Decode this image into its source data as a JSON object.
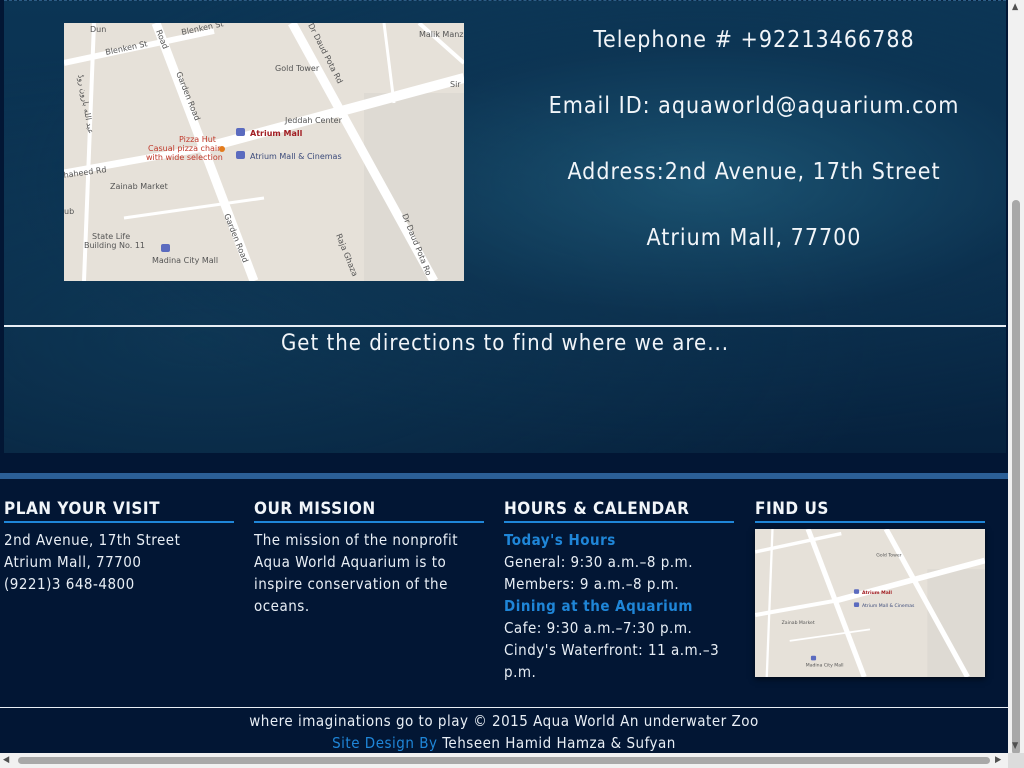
{
  "contact": {
    "telephone": "Telephone # +92213466788",
    "email": "Email ID: aquaworld@aquarium.com",
    "address": "Address:2nd Avenue, 17th Street",
    "mall": "Atrium Mall, 77700",
    "directions": "Get the directions to find where we are..."
  },
  "map": {
    "labels": {
      "dunes": "Dun",
      "blenken1": "Blenken St",
      "blenken2": "Blenken St",
      "garden_road_top": "Garden Road",
      "road": "Road",
      "dr_daud_pota_top": "Dr Daud Pota Rd",
      "malik_manzil": "Malik Manzil",
      "gold_tower": "Gold Tower",
      "arabic_road": "عبد الله بارون روڈ",
      "sir": "Sir",
      "jeddah_center": "Jeddah Center",
      "pizza_hut": "Pizza Hut",
      "pizza_desc1": "Casual pizza chain",
      "pizza_desc2": "with wide selection",
      "atrium_mall": "Atrium Mall",
      "atrium_cinemas": "Atrium Mall & Cinemas",
      "shaheed_rd": "haheed Rd",
      "zainab_market": "Zainab Market",
      "ub": "ub",
      "garden_road_bottom": "Garden Road",
      "dr_daud_pota_bottom": "Dr Daud Pota Ro",
      "raja_ghaza": "Raja Ghaza",
      "state_life1": "State Life",
      "state_life2": "Building No. 11",
      "madina_city_mall": "Madina City Mall"
    }
  },
  "footer": {
    "plan": {
      "heading": "PLAN YOUR VISIT",
      "line1": "2nd Avenue, 17th Street",
      "line2": "Atrium Mall, 77700",
      "line3": "(9221)3 648-4800"
    },
    "mission": {
      "heading": "OUR MISSION",
      "text": "The mission of the nonprofit Aqua World Aquarium is to inspire conservation of the oceans."
    },
    "hours": {
      "heading": "HOURS & CALENDAR",
      "today_heading": "Today's Hours",
      "general": "General: 9:30 a.m.–8 p.m.",
      "members": "Members: 9 a.m.–8 p.m.",
      "dining_heading": "Dining at the Aquarium",
      "cafe": "Cafe: 9:30 a.m.–7:30 p.m.",
      "cindy": "Cindy's Waterfront: 11 a.m.–3 p.m."
    },
    "find": {
      "heading": "FIND US"
    },
    "copyright": "where imaginations go to play © 2015 Aqua World An underwater Zoo",
    "credit_label": "Site Design By",
    "credit_names": "Tehseen Hamid Hamza & Sufyan"
  },
  "colors": {
    "accent": "#1f86d8",
    "footer_bg": "#021634",
    "footer_bar": "#2b5f97"
  }
}
